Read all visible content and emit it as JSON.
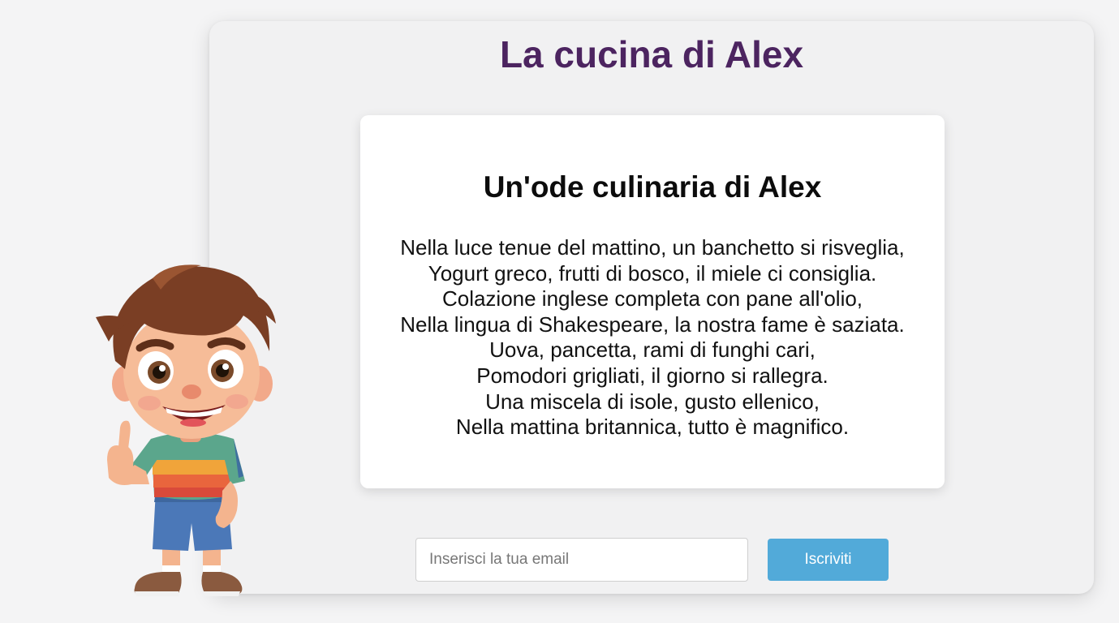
{
  "header": {
    "title": "La cucina di Alex"
  },
  "poem": {
    "title": "Un'ode culinaria di Alex",
    "lines": [
      "Nella luce tenue del mattino, un banchetto si risveglia,",
      "Yogurt greco, frutti di bosco, il miele ci consiglia.",
      "Colazione inglese completa con pane all'olio,",
      "Nella lingua di Shakespeare, la nostra fame è saziata.",
      "Uova, pancetta, rami di funghi cari,",
      "Pomodori grigliati, il giorno si rallegra.",
      "Una miscela di isole, gusto ellenico,",
      "Nella mattina britannica, tutto è magnifico."
    ]
  },
  "subscribe": {
    "email_placeholder": "Inserisci la tua email",
    "email_value": "",
    "button_label": "Iscriviti",
    "button_color": "#52aad9"
  },
  "colors": {
    "title": "#4c2460",
    "background": "#f1f1f2"
  },
  "mascot": {
    "icon": "cartoon-boy-thumbs-up-icon"
  }
}
